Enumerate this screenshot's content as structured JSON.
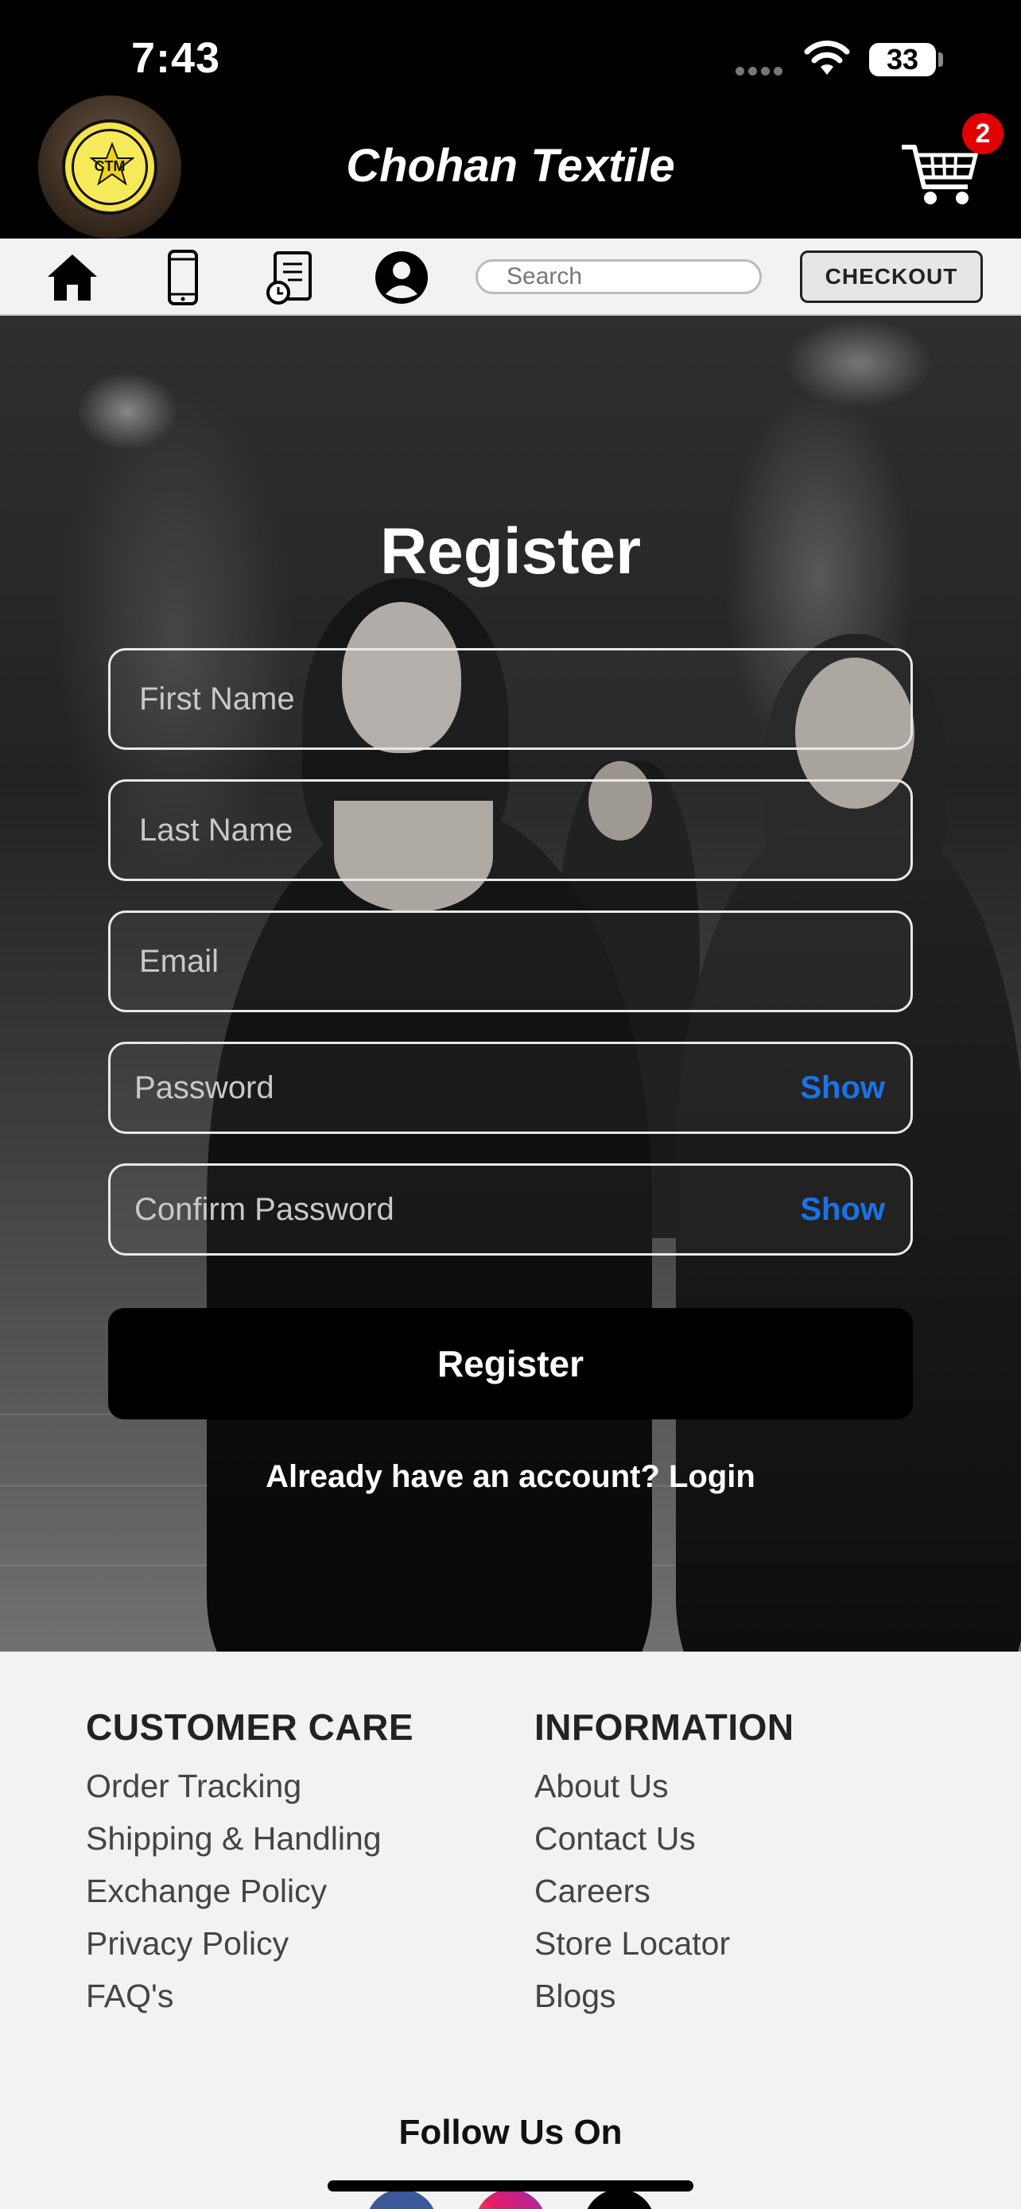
{
  "status_bar": {
    "time": "7:43",
    "battery": "33"
  },
  "header": {
    "title": "Chohan Textile",
    "logo_text": "CTM",
    "cart_count": "2"
  },
  "nav": {
    "search_placeholder": "Search",
    "checkout_label": "CHECKOUT"
  },
  "register": {
    "title": "Register",
    "fields": {
      "first_name": "First Name",
      "last_name": "Last Name",
      "email": "Email",
      "password": "Password",
      "confirm_password": "Confirm Password"
    },
    "show_label": "Show",
    "submit_label": "Register",
    "login_prompt": "Already have an account? Login"
  },
  "footer": {
    "customer_care": {
      "heading": "CUSTOMER CARE",
      "links": [
        "Order Tracking",
        "Shipping & Handling",
        "Exchange Policy",
        "Privacy Policy",
        "FAQ's"
      ]
    },
    "information": {
      "heading": "INFORMATION",
      "links": [
        "About Us",
        "Contact Us",
        "Careers",
        "Store Locator",
        "Blogs"
      ]
    },
    "follow_label": "Follow Us On"
  },
  "colors": {
    "accent_blue": "#1a73e8",
    "badge_red": "#e30000",
    "header_bg": "#000000"
  }
}
